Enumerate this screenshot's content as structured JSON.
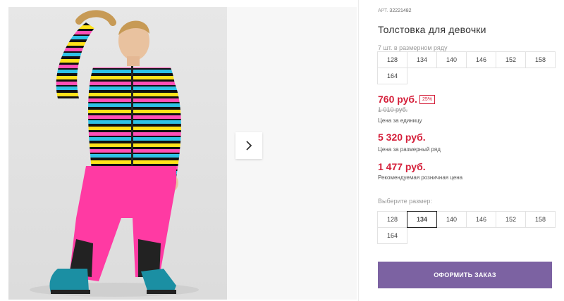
{
  "product": {
    "article_label": "АРТ.",
    "article_number": "32221482",
    "title": "Толстовка для девочки",
    "lineup_hint": "7 шт. в размерном ряду",
    "lineup_sizes": [
      "128",
      "134",
      "140",
      "146",
      "152",
      "158",
      "164"
    ]
  },
  "pricing": {
    "unit_price": "760 руб.",
    "discount_badge": "25%",
    "old_price": "1 010 руб.",
    "unit_price_caption": "Цена за единицу",
    "lineup_price": "5 320 руб.",
    "lineup_price_caption": "Цена за размерный ряд",
    "retail_price": "1 477 руб.",
    "retail_price_caption": "Рекомендуемая розничная цена"
  },
  "size_selector": {
    "label": "Выберите размер:",
    "sizes": [
      "128",
      "134",
      "140",
      "146",
      "152",
      "158",
      "164"
    ],
    "selected": "134"
  },
  "order_button": {
    "label": "ОФОРМИТЬ ЗАКАЗ"
  },
  "colors": {
    "accent_purple": "#7c62a2",
    "price_red": "#d51f3a",
    "pants_pink": "#ff3aa3"
  },
  "icons": {
    "next": "chevron-right-icon"
  }
}
